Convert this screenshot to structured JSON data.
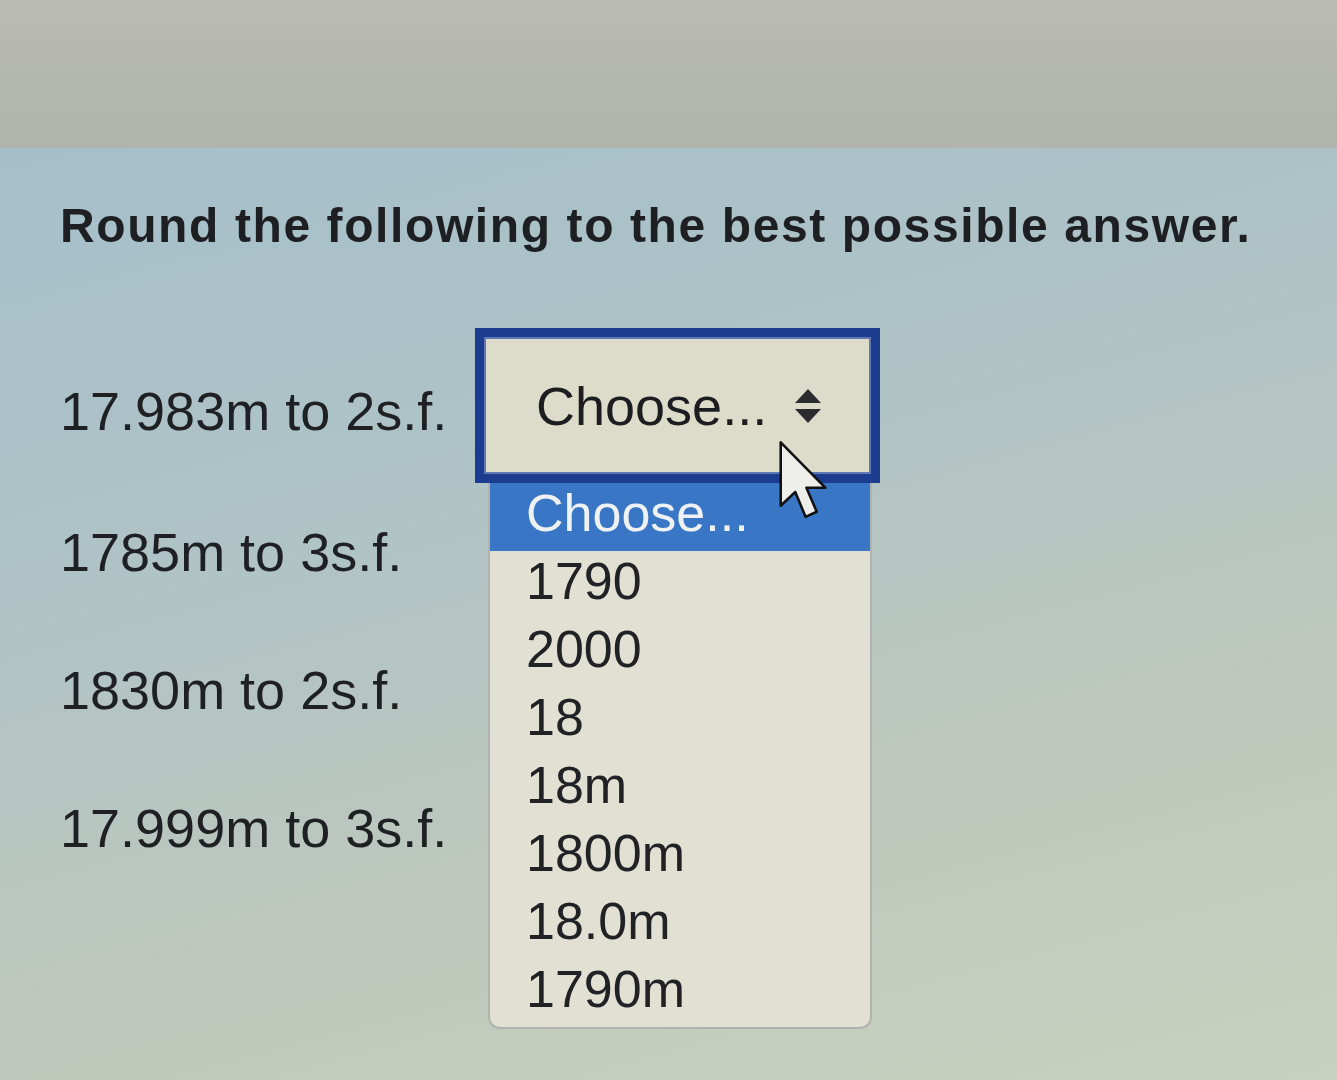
{
  "instruction": "Round the following to the best possible answer.",
  "questions": [
    {
      "prompt": "17.983m to 2s.f.",
      "dropdown": {
        "value": "Choose...",
        "expanded": true,
        "options": [
          {
            "label": "Choose...",
            "selected": true
          },
          {
            "label": "1790",
            "selected": false
          },
          {
            "label": "2000",
            "selected": false
          },
          {
            "label": "18",
            "selected": false
          },
          {
            "label": "18m",
            "selected": false
          },
          {
            "label": "1800m",
            "selected": false
          },
          {
            "label": "18.0m",
            "selected": false
          },
          {
            "label": "1790m",
            "selected": false
          }
        ]
      }
    },
    {
      "prompt": "1785m to 3s.f."
    },
    {
      "prompt": "1830m to 2s.f."
    },
    {
      "prompt": "17.999m to 3s.f."
    }
  ]
}
